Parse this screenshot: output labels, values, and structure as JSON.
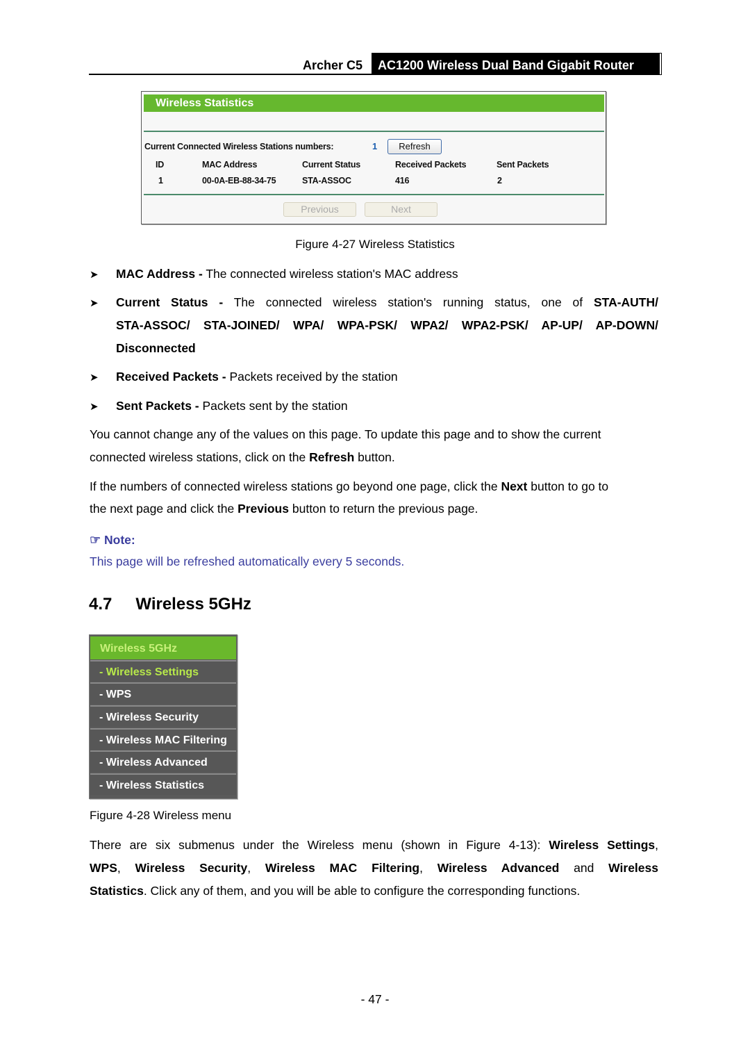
{
  "header": {
    "model": "Archer C5",
    "product": "AC1200 Wireless Dual Band Gigabit Router"
  },
  "figure1": {
    "panel_title": "Wireless Statistics",
    "stations_label": "Current Connected Wireless Stations numbers:",
    "stations_count": "1",
    "refresh_label": "Refresh",
    "columns": [
      "ID",
      "MAC Address",
      "Current Status",
      "Received Packets",
      "Sent Packets"
    ],
    "rows": [
      [
        "1",
        "00-0A-EB-88-34-75",
        "STA-ASSOC",
        "416",
        "2"
      ]
    ],
    "previous_label": "Previous",
    "next_label": "Next",
    "caption": "Figure 4-27 Wireless Statistics"
  },
  "bullets": [
    {
      "term": "MAC Address -",
      "desc": " The connected wireless station's MAC address"
    },
    {
      "term": "Current Status -",
      "desc": " The connected wireless station's running status, one of ",
      "line1_bold": "STA-AUTH/",
      "line2_bold": "STA-ASSOC/ STA-JOINED/ WPA/ WPA-PSK/ WPA2/ WPA2-PSK/ AP-UP/ AP-DOWN/",
      "line3_bold": "Disconnected"
    },
    {
      "term": "Received Packets -",
      "desc": " Packets received by the station"
    },
    {
      "term": "Sent Packets -",
      "desc": " Packets sent by the station"
    }
  ],
  "para1": {
    "line1": "You cannot change any of the values on this page. To update this page and to show the current",
    "line2_a": "connected wireless stations, click on the ",
    "line2_b": "Refresh",
    "line2_c": " button."
  },
  "para2": {
    "line1_a": "If the numbers of connected wireless stations go beyond one page, click the ",
    "line1_b": "Next",
    "line1_c": " button to go to",
    "line2_a": "the next page and click the ",
    "line2_b": "Previous",
    "line2_c": " button to return the previous page."
  },
  "note": {
    "icon": "pointing-hand-icon",
    "heading": "Note:",
    "text": "This page will be refreshed automatically every 5 seconds."
  },
  "section": {
    "number": "4.7",
    "title": "Wireless 5GHz"
  },
  "menu": {
    "heading": "Wireless 5GHz",
    "items": [
      {
        "label": "- Wireless Settings",
        "active": true
      },
      {
        "label": "- WPS",
        "active": false
      },
      {
        "label": "- Wireless Security",
        "active": false
      },
      {
        "label": "- Wireless MAC Filtering",
        "active": false
      },
      {
        "label": "- Wireless Advanced",
        "active": false
      },
      {
        "label": "- Wireless Statistics",
        "active": false
      }
    ],
    "caption": "Figure 4-28 Wireless menu"
  },
  "para3": {
    "l1_a": "There are six submenus under the Wireless menu (shown in Figure 4-13): ",
    "l1_b": "Wireless Settings",
    "l1_c": ",",
    "l2_a": "WPS",
    "l2_b": ", ",
    "l2_c": "Wireless Security",
    "l2_d": ", ",
    "l2_e": "Wireless MAC Filtering",
    "l2_f": ", ",
    "l2_g": "Wireless Advanced",
    "l2_h": " and ",
    "l2_i": "Wireless",
    "l3_a": "Statistics",
    "l3_b": ". Click any of them, and you will be able to configure the corresponding functions."
  },
  "page_number": "- 47 -",
  "colors": {
    "panel_green": "#66b82e",
    "menu_gray": "#575757",
    "menu_active_text": "#b7e84a",
    "note_blue": "#3a3d9e",
    "count_blue": "#1c5fb0"
  }
}
